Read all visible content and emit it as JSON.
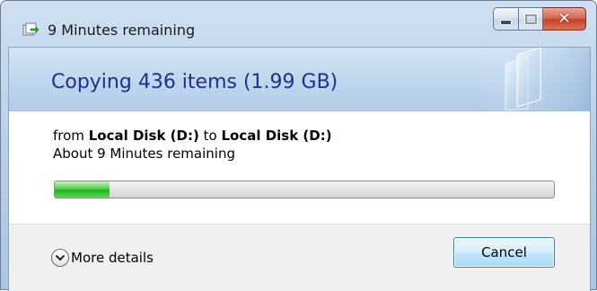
{
  "window": {
    "title": "9 Minutes remaining"
  },
  "caption_buttons": {
    "minimize_glyph": "minimize-icon",
    "maximize_glyph": "maximize-icon",
    "close_label": "✕"
  },
  "header": {
    "title": "Copying 436 items (1.99 GB)"
  },
  "info": {
    "from_prefix": "from",
    "source": "Local Disk (D:)",
    "to_prefix": "to",
    "destination": "Local Disk (D:)",
    "time_remaining": "About 9 Minutes remaining"
  },
  "progress": {
    "percent": 11
  },
  "footer": {
    "more_details_label": "More details",
    "cancel_label": "Cancel"
  },
  "colors": {
    "header_title": "#1e3287",
    "progress_fill": "#2ec12b",
    "close_button": "#c7402a"
  }
}
